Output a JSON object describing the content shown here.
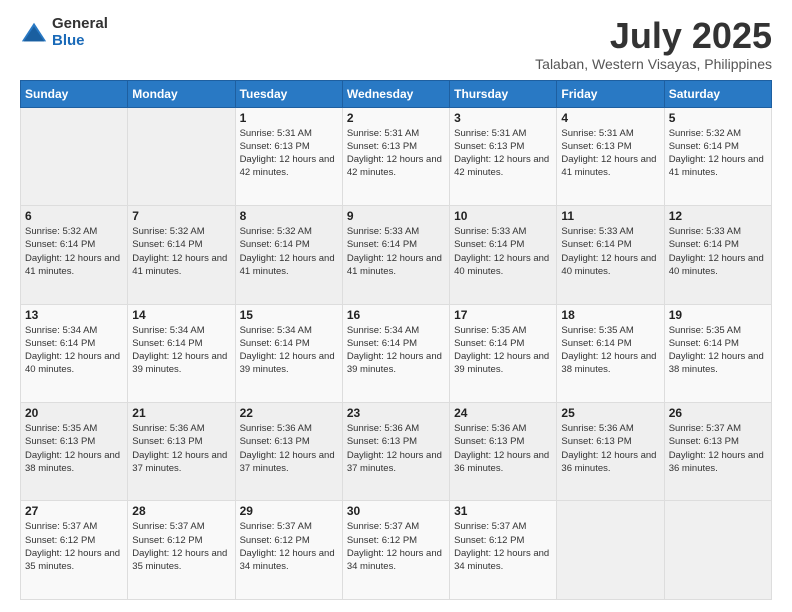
{
  "logo": {
    "general": "General",
    "blue": "Blue"
  },
  "header": {
    "title": "July 2025",
    "subtitle": "Talaban, Western Visayas, Philippines"
  },
  "weekdays": [
    "Sunday",
    "Monday",
    "Tuesday",
    "Wednesday",
    "Thursday",
    "Friday",
    "Saturday"
  ],
  "weeks": [
    [
      null,
      null,
      {
        "day": 1,
        "sunrise": "5:31 AM",
        "sunset": "6:13 PM",
        "daylight": "12 hours and 42 minutes."
      },
      {
        "day": 2,
        "sunrise": "5:31 AM",
        "sunset": "6:13 PM",
        "daylight": "12 hours and 42 minutes."
      },
      {
        "day": 3,
        "sunrise": "5:31 AM",
        "sunset": "6:13 PM",
        "daylight": "12 hours and 42 minutes."
      },
      {
        "day": 4,
        "sunrise": "5:31 AM",
        "sunset": "6:13 PM",
        "daylight": "12 hours and 41 minutes."
      },
      {
        "day": 5,
        "sunrise": "5:32 AM",
        "sunset": "6:14 PM",
        "daylight": "12 hours and 41 minutes."
      }
    ],
    [
      {
        "day": 6,
        "sunrise": "5:32 AM",
        "sunset": "6:14 PM",
        "daylight": "12 hours and 41 minutes."
      },
      {
        "day": 7,
        "sunrise": "5:32 AM",
        "sunset": "6:14 PM",
        "daylight": "12 hours and 41 minutes."
      },
      {
        "day": 8,
        "sunrise": "5:32 AM",
        "sunset": "6:14 PM",
        "daylight": "12 hours and 41 minutes."
      },
      {
        "day": 9,
        "sunrise": "5:33 AM",
        "sunset": "6:14 PM",
        "daylight": "12 hours and 41 minutes."
      },
      {
        "day": 10,
        "sunrise": "5:33 AM",
        "sunset": "6:14 PM",
        "daylight": "12 hours and 40 minutes."
      },
      {
        "day": 11,
        "sunrise": "5:33 AM",
        "sunset": "6:14 PM",
        "daylight": "12 hours and 40 minutes."
      },
      {
        "day": 12,
        "sunrise": "5:33 AM",
        "sunset": "6:14 PM",
        "daylight": "12 hours and 40 minutes."
      }
    ],
    [
      {
        "day": 13,
        "sunrise": "5:34 AM",
        "sunset": "6:14 PM",
        "daylight": "12 hours and 40 minutes."
      },
      {
        "day": 14,
        "sunrise": "5:34 AM",
        "sunset": "6:14 PM",
        "daylight": "12 hours and 39 minutes."
      },
      {
        "day": 15,
        "sunrise": "5:34 AM",
        "sunset": "6:14 PM",
        "daylight": "12 hours and 39 minutes."
      },
      {
        "day": 16,
        "sunrise": "5:34 AM",
        "sunset": "6:14 PM",
        "daylight": "12 hours and 39 minutes."
      },
      {
        "day": 17,
        "sunrise": "5:35 AM",
        "sunset": "6:14 PM",
        "daylight": "12 hours and 39 minutes."
      },
      {
        "day": 18,
        "sunrise": "5:35 AM",
        "sunset": "6:14 PM",
        "daylight": "12 hours and 38 minutes."
      },
      {
        "day": 19,
        "sunrise": "5:35 AM",
        "sunset": "6:14 PM",
        "daylight": "12 hours and 38 minutes."
      }
    ],
    [
      {
        "day": 20,
        "sunrise": "5:35 AM",
        "sunset": "6:13 PM",
        "daylight": "12 hours and 38 minutes."
      },
      {
        "day": 21,
        "sunrise": "5:36 AM",
        "sunset": "6:13 PM",
        "daylight": "12 hours and 37 minutes."
      },
      {
        "day": 22,
        "sunrise": "5:36 AM",
        "sunset": "6:13 PM",
        "daylight": "12 hours and 37 minutes."
      },
      {
        "day": 23,
        "sunrise": "5:36 AM",
        "sunset": "6:13 PM",
        "daylight": "12 hours and 37 minutes."
      },
      {
        "day": 24,
        "sunrise": "5:36 AM",
        "sunset": "6:13 PM",
        "daylight": "12 hours and 36 minutes."
      },
      {
        "day": 25,
        "sunrise": "5:36 AM",
        "sunset": "6:13 PM",
        "daylight": "12 hours and 36 minutes."
      },
      {
        "day": 26,
        "sunrise": "5:37 AM",
        "sunset": "6:13 PM",
        "daylight": "12 hours and 36 minutes."
      }
    ],
    [
      {
        "day": 27,
        "sunrise": "5:37 AM",
        "sunset": "6:12 PM",
        "daylight": "12 hours and 35 minutes."
      },
      {
        "day": 28,
        "sunrise": "5:37 AM",
        "sunset": "6:12 PM",
        "daylight": "12 hours and 35 minutes."
      },
      {
        "day": 29,
        "sunrise": "5:37 AM",
        "sunset": "6:12 PM",
        "daylight": "12 hours and 34 minutes."
      },
      {
        "day": 30,
        "sunrise": "5:37 AM",
        "sunset": "6:12 PM",
        "daylight": "12 hours and 34 minutes."
      },
      {
        "day": 31,
        "sunrise": "5:37 AM",
        "sunset": "6:12 PM",
        "daylight": "12 hours and 34 minutes."
      },
      null,
      null
    ]
  ]
}
